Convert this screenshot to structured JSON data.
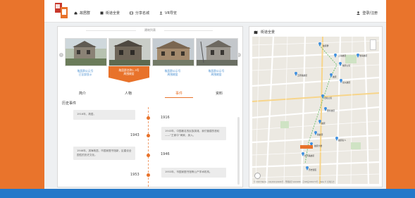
{
  "nav": {
    "items": [
      {
        "icon": "home-icon",
        "label": "故居群"
      },
      {
        "icon": "bookmark-icon",
        "label": "街道全景"
      },
      {
        "icon": "chart-icon",
        "label": "分享名城"
      },
      {
        "icon": "user-group-icon",
        "label": "VR导览"
      }
    ],
    "user_label": "登录/注册"
  },
  "left": {
    "related_title": "建筑列表",
    "arrow_prev": "‹",
    "arrow_next": "›",
    "cards": [
      {
        "caption": "故居群公示号\n已全部显示"
      },
      {
        "caption": "故居群名称1-3号\n周围故居"
      },
      {
        "caption": "故居群公示号\n周围故居"
      },
      {
        "caption": "故居群公示号\n周围故居"
      }
    ],
    "tabs": [
      "简介",
      "人物",
      "事件",
      "资料"
    ],
    "active_tab": 2,
    "section_title": "历史事件"
  },
  "timeline": {
    "events": [
      {
        "side": "left",
        "year": "1916",
        "text": "1916年，故居。"
      },
      {
        "side": "right",
        "year": "1943",
        "text": "1943年，中国著名的民族英雄，我们营建的首轮——“王家中”两家，身入。"
      },
      {
        "side": "left",
        "year": "1946",
        "text": "1946年，滨海故居，市国家图书馆新，区建设全国性的历史文化。"
      },
      {
        "side": "right",
        "year": "1953",
        "text": "1953年，市国家图书馆等公产学术机构。"
      }
    ]
  },
  "map": {
    "title": "街道全景",
    "credit": "© 2023 Baidu - GS(2021)6026号 - 甲测资字1100930 - 京ICP证030173号 - Data © 长地万方",
    "labels": [
      "故居群",
      "上海故居",
      "故居公馆",
      "淮海故居",
      "五原路故居",
      "故居",
      "复兴故居",
      "旧址公馆",
      "国家故居",
      "故居",
      "路故居",
      "故居大楼",
      "长乐路故居",
      "故居名人",
      "历史街区"
    ]
  },
  "colors": {
    "accent": "#e8722a",
    "link": "#4a8fd0",
    "page_bg": "#e9742c",
    "band": "#2478c9"
  }
}
